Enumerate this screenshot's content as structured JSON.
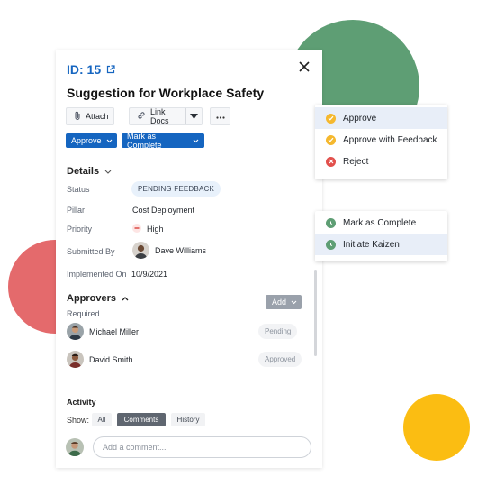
{
  "colors": {
    "primary": "#1565c0",
    "green_blob": "#5e9e74",
    "red_blob": "#e46a6c",
    "yellow_blob": "#fbbd12",
    "approve_icon": "#f5b82e",
    "reject_icon": "#e2504c",
    "complete_icon": "#5e9e74"
  },
  "header": {
    "id_label": "ID: 15",
    "external_icon": "external-link-icon",
    "close_icon": "close-icon"
  },
  "title": "Suggestion for Workplace Safety",
  "toolbar": {
    "attach": "Attach",
    "link_docs": "Link Docs",
    "more_icon": "ellipsis-icon"
  },
  "actions": {
    "approve": "Approve",
    "mark_complete": "Mark as Complete"
  },
  "details": {
    "heading": "Details",
    "status": {
      "label": "Status",
      "value": "PENDING FEEDBACK"
    },
    "pillar": {
      "label": "Pillar",
      "value": "Cost Deployment"
    },
    "priority": {
      "label": "Priority",
      "value": "High"
    },
    "submitted_by": {
      "label": "Submitted By",
      "value": "Dave Williams"
    },
    "implemented_on": {
      "label": "Implemented On",
      "value": "10/9/2021"
    }
  },
  "approvers": {
    "heading": "Approvers",
    "required_label": "Required",
    "add_label": "Add",
    "items": [
      {
        "name": "Michael Miller",
        "status": "Pending"
      },
      {
        "name": "David Smith",
        "status": "Approved"
      }
    ]
  },
  "activity": {
    "heading": "Activity",
    "show_label": "Show:",
    "filters": [
      "All",
      "Comments",
      "History"
    ],
    "active_filter": "Comments",
    "comment_placeholder": "Add a comment..."
  },
  "approve_menu": {
    "items": [
      "Approve",
      "Approve with Feedback",
      "Reject"
    ],
    "highlighted": "Approve"
  },
  "complete_menu": {
    "items": [
      "Mark as Complete",
      "Initiate Kaizen"
    ],
    "highlighted": "Initiate Kaizen"
  }
}
